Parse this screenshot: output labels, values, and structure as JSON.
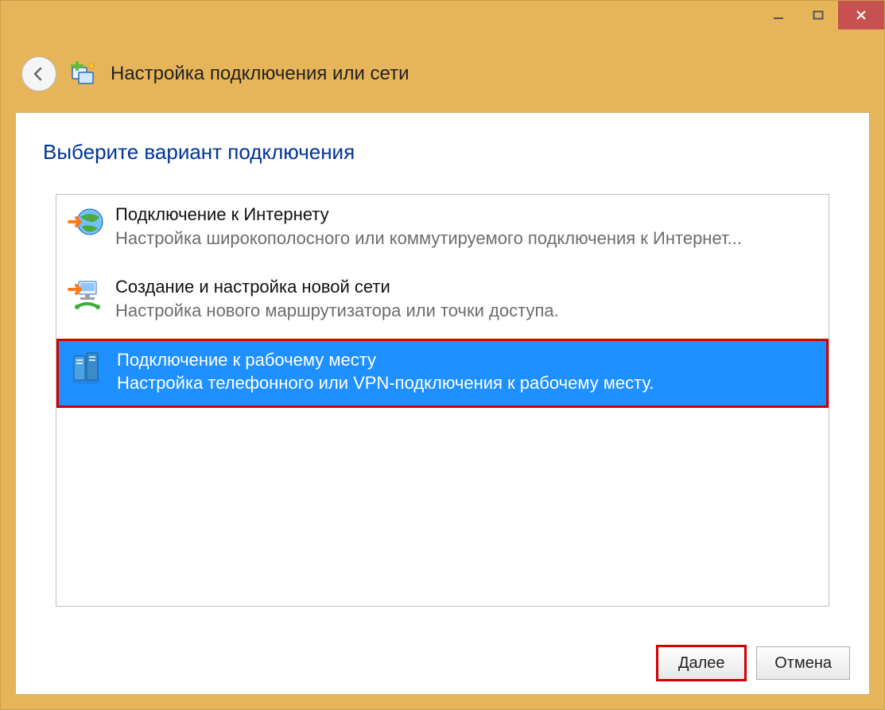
{
  "window": {
    "title": "Настройка подключения или сети"
  },
  "main": {
    "instruction": "Выберите вариант подключения",
    "options": [
      {
        "title": "Подключение к Интернету",
        "desc": "Настройка широкополосного или коммутируемого подключения к Интернет...",
        "selected": false
      },
      {
        "title": "Создание и настройка новой сети",
        "desc": "Настройка нового маршрутизатора или точки доступа.",
        "selected": false
      },
      {
        "title": "Подключение к рабочему месту",
        "desc": "Настройка телефонного или VPN-подключения к рабочему месту.",
        "selected": true
      }
    ]
  },
  "footer": {
    "next": "Далее",
    "cancel": "Отмена"
  }
}
